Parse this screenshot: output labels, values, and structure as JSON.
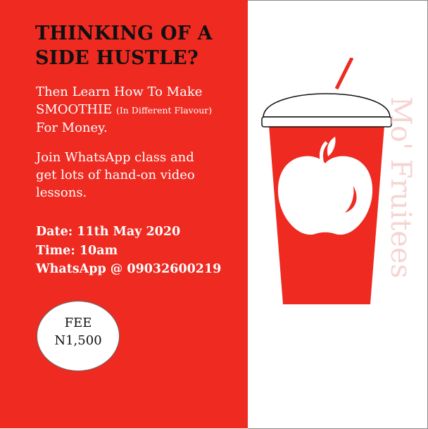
{
  "headline": {
    "line1": "THINKING OF A",
    "line2": "SIDE HUSTLE?"
  },
  "intro": {
    "line1": "Then Learn How To Make",
    "smoothie": "SMOOTHIE",
    "flavour_note": "(In Different Flavour)",
    "line3": "For Money."
  },
  "class_info": {
    "line1": "Join WhatsApp class and",
    "line2": "get lots of hand-on video",
    "line3": "lessons."
  },
  "event": {
    "date": "Date: 11th May 2020",
    "time": "Time: 10am",
    "contact": "WhatsApp @ 09032600219"
  },
  "fee": {
    "label": "FEE",
    "amount": "N1,500"
  },
  "brand": {
    "watermark": "Mo' Fruitees"
  },
  "colors": {
    "panel_red": "#ee2a21",
    "cup_red": "#ee2a21",
    "headline_text": "#111111",
    "watermark": "#f6d4d2"
  },
  "icons": {
    "cup": "smoothie-cup-icon",
    "apple": "apple-icon",
    "straw": "straw-icon"
  }
}
